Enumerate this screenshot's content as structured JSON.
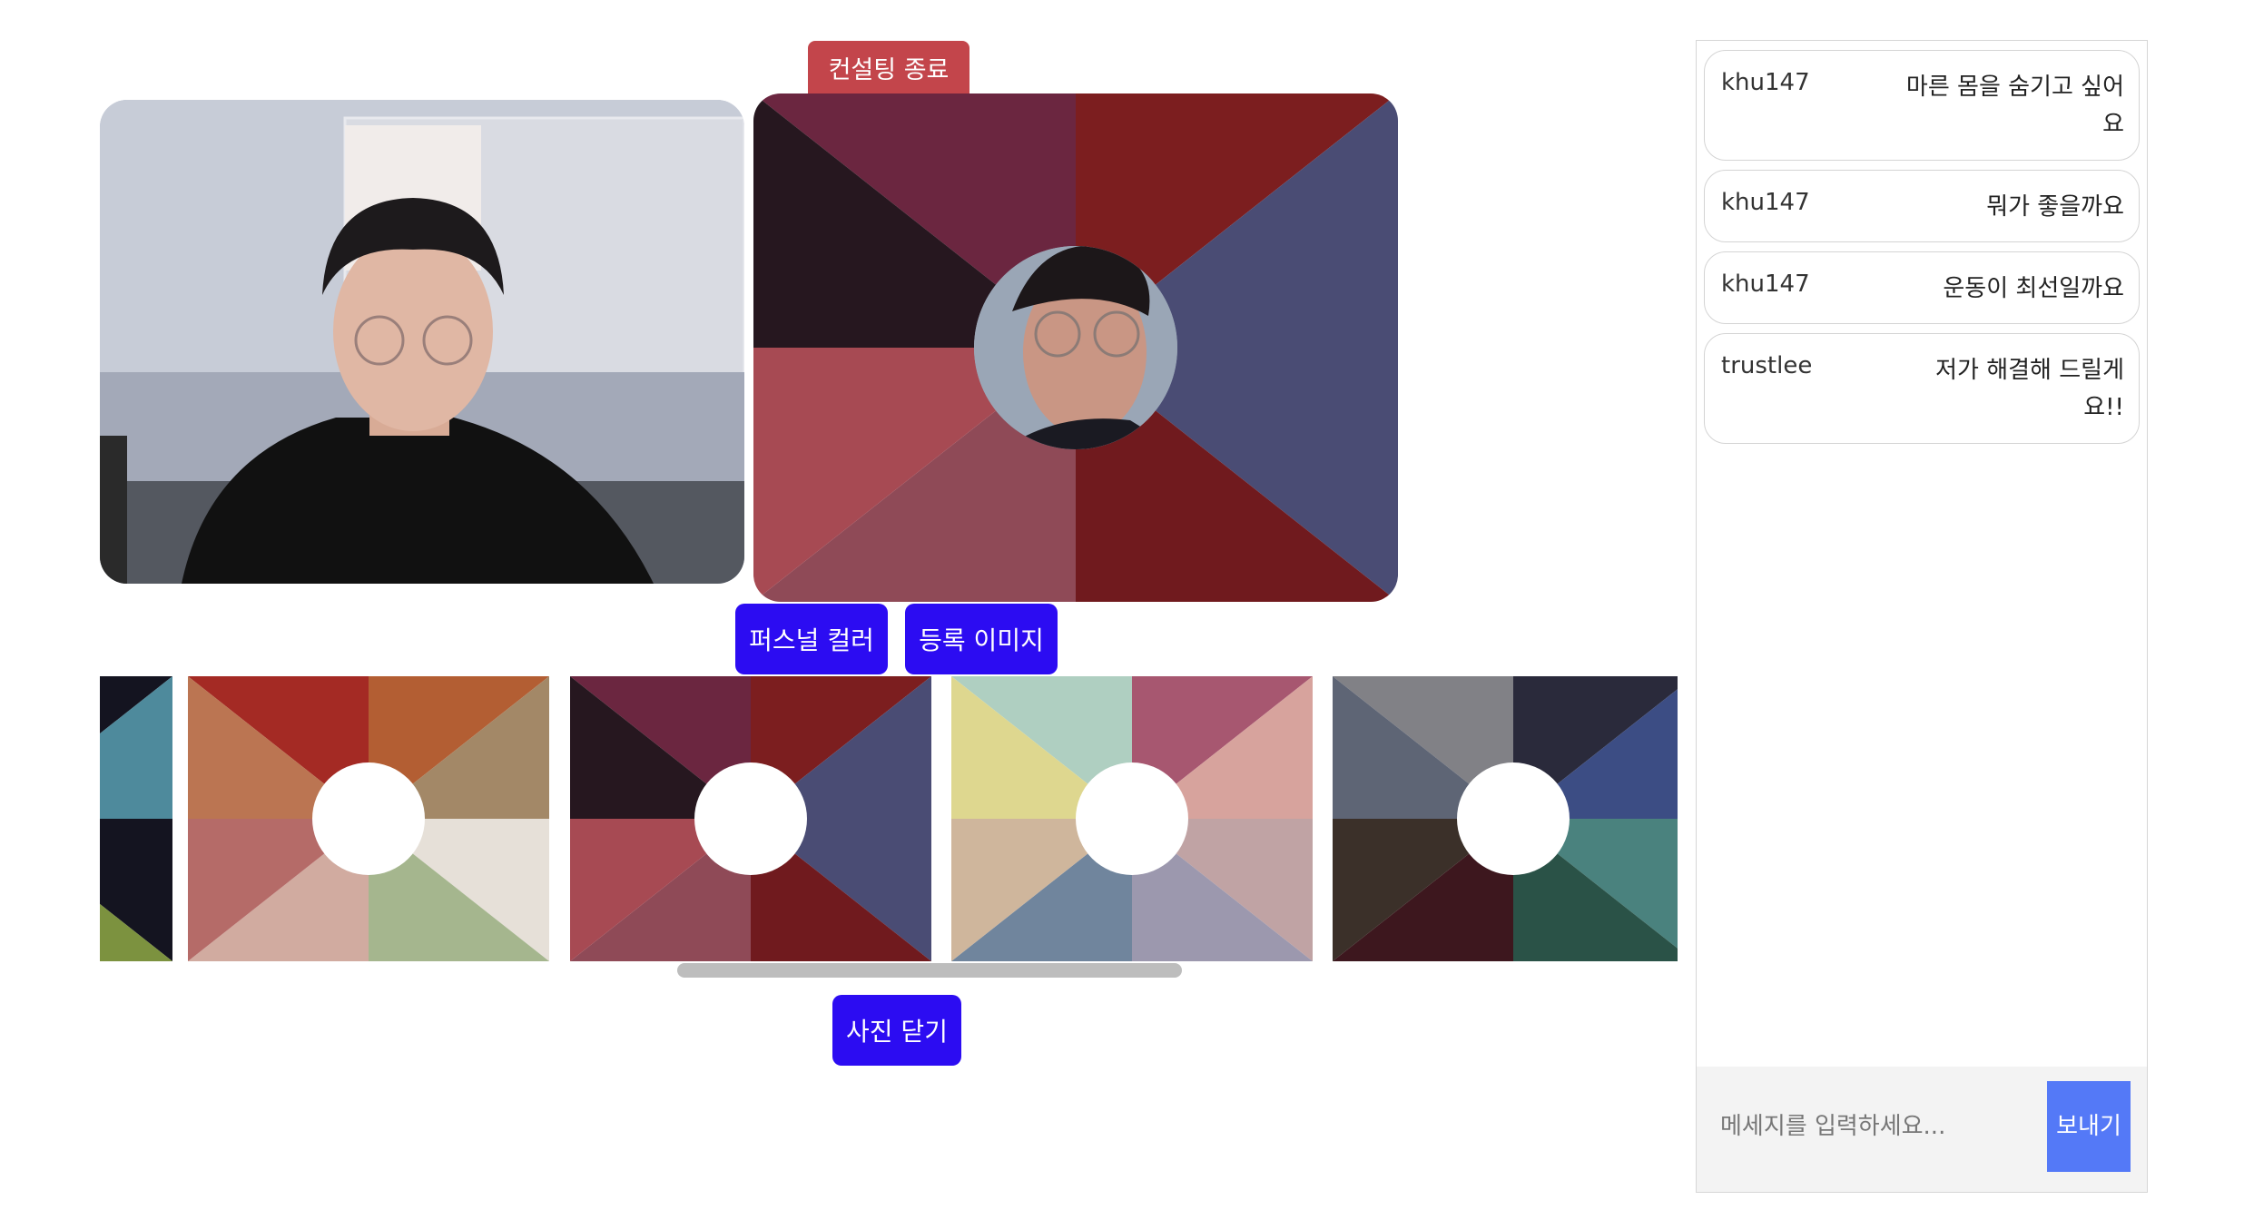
{
  "header": {
    "end_button": "컨설팅 종료"
  },
  "tabs": [
    {
      "label": "퍼스널 컬러"
    },
    {
      "label": "등록 이미지"
    }
  ],
  "gallery": {
    "close_button": "사진 닫기",
    "palettes": [
      {
        "name": "palette-partial",
        "colors": [
          "#7c923f",
          "#141420",
          "#4e8a9c",
          "#141420",
          "#7c923f",
          "#141420",
          "#141420",
          "#141420"
        ]
      },
      {
        "name": "palette-warm",
        "colors": [
          "#a42a24",
          "#b35e33",
          "#a38867",
          "#e6e0d8",
          "#a5b68e",
          "#d1aba0",
          "#b56b68",
          "#bb7552"
        ]
      },
      {
        "name": "palette-deep",
        "colors": [
          "#6b2640",
          "#7c1e1f",
          "#4a4c74",
          "#4a4c74",
          "#701a1e",
          "#8f4a57",
          "#a74a53",
          "#26171f"
        ]
      },
      {
        "name": "palette-soft",
        "colors": [
          "#afcfc1",
          "#a75770",
          "#d7a39d",
          "#c0a3a4",
          "#9c98ae",
          "#70859d",
          "#cfb69c",
          "#ded78f"
        ]
      },
      {
        "name": "palette-cool",
        "colors": [
          "#818186",
          "#2a2a3b",
          "#3c4d84",
          "#4a827e",
          "#2a5247",
          "#3d171e",
          "#3b3029",
          "#5e6575"
        ]
      }
    ]
  },
  "main_palette": {
    "colors": [
      "#6b2640",
      "#7c1e1f",
      "#4a4c74",
      "#4a4c74",
      "#701a1e",
      "#8f4a57",
      "#a74a53",
      "#26171f"
    ]
  },
  "chat": {
    "messages": [
      {
        "user": "khu147",
        "text": "마른 몸을 숨기고 싶어요"
      },
      {
        "user": "khu147",
        "text": "뭐가 좋을까요"
      },
      {
        "user": "khu147",
        "text": "운동이 최선일까요"
      },
      {
        "user": "trustlee",
        "text": "저가 해결해 드릴게요!!"
      }
    ],
    "input_placeholder": "메세지를 입력하세요...",
    "send_button": "보내기"
  }
}
